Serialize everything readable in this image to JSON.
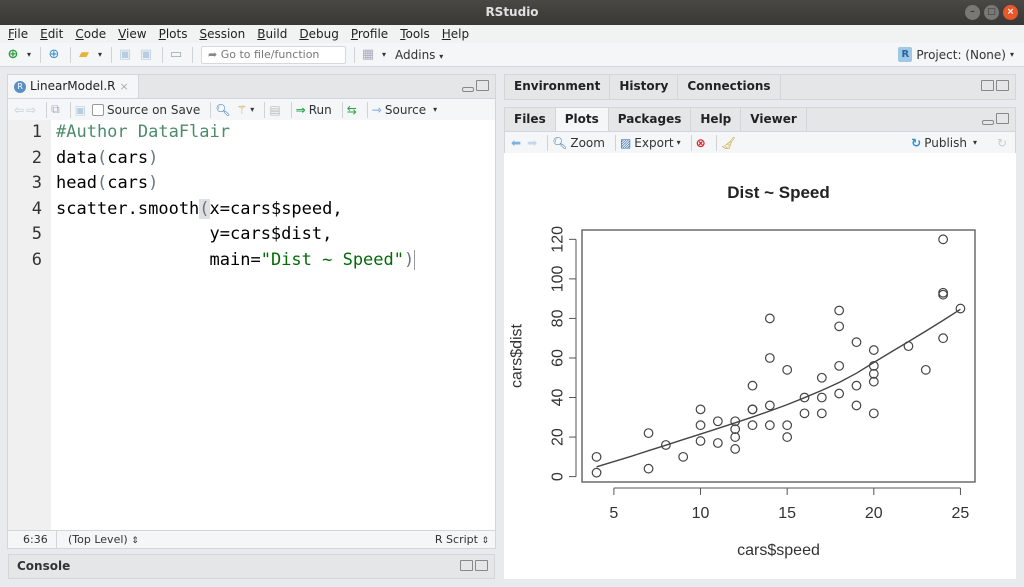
{
  "window": {
    "title": "RStudio",
    "controls": [
      "minimize",
      "maximize",
      "close"
    ]
  },
  "menubar": {
    "items": [
      {
        "label": "File",
        "u": "F"
      },
      {
        "label": "Edit",
        "u": "E"
      },
      {
        "label": "Code",
        "u": "C"
      },
      {
        "label": "View",
        "u": "V"
      },
      {
        "label": "Plots",
        "u": "P"
      },
      {
        "label": "Session",
        "u": "S"
      },
      {
        "label": "Build",
        "u": "B"
      },
      {
        "label": "Debug",
        "u": "D"
      },
      {
        "label": "Profile",
        "u": "P"
      },
      {
        "label": "Tools",
        "u": "T"
      },
      {
        "label": "Help",
        "u": "H"
      }
    ]
  },
  "main_toolbar": {
    "goto_placeholder": "Go to file/function",
    "addins_label": "Addins",
    "project_label": "Project: (None)"
  },
  "source_pane": {
    "tab_label": "LinearModel.R",
    "source_on_save_label": "Source on Save",
    "source_on_save_checked": false,
    "run_label": "Run",
    "source_label": "Source",
    "code_lines": [
      {
        "n": "1",
        "text": "#Author DataFlair"
      },
      {
        "n": "2",
        "text": "data(cars)"
      },
      {
        "n": "3",
        "text": "head(cars)"
      },
      {
        "n": "4",
        "text": "scatter.smooth(x=cars$speed,"
      },
      {
        "n": "5",
        "text": "               y=cars$dist,"
      },
      {
        "n": "6",
        "text": "               main=\"Dist ~ Speed\")"
      }
    ],
    "status": {
      "position": "6:36",
      "scope": "(Top Level)",
      "file_type": "R Script"
    }
  },
  "console_pane": {
    "label": "Console"
  },
  "env_pane": {
    "tabs": [
      "Environment",
      "History",
      "Connections"
    ],
    "active_tab": "Environment"
  },
  "files_pane": {
    "tabs": [
      "Files",
      "Plots",
      "Packages",
      "Help",
      "Viewer"
    ],
    "active_tab": "Plots",
    "zoom_label": "Zoom",
    "export_label": "Export",
    "publish_label": "Publish"
  },
  "chart_data": {
    "type": "scatter",
    "title": "Dist ~ Speed",
    "xlabel": "cars$speed",
    "ylabel": "cars$dist",
    "xlim": [
      3.16,
      25.84
    ],
    "ylim": [
      -2.72,
      124.72
    ],
    "xticks": [
      5,
      10,
      15,
      20,
      25
    ],
    "yticks": [
      0,
      20,
      40,
      60,
      80,
      100,
      120
    ],
    "grid": false,
    "legend": "none",
    "series": [
      {
        "name": "points",
        "x": [
          4,
          4,
          7,
          7,
          8,
          9,
          10,
          10,
          10,
          11,
          11,
          12,
          12,
          12,
          12,
          13,
          13,
          13,
          13,
          14,
          14,
          14,
          14,
          15,
          15,
          15,
          16,
          16,
          17,
          17,
          17,
          18,
          18,
          18,
          18,
          19,
          19,
          19,
          20,
          20,
          20,
          20,
          20,
          22,
          23,
          24,
          24,
          24,
          24,
          25
        ],
        "y": [
          2,
          10,
          4,
          22,
          16,
          10,
          18,
          26,
          34,
          17,
          28,
          14,
          20,
          24,
          28,
          26,
          34,
          34,
          46,
          26,
          36,
          60,
          80,
          20,
          26,
          54,
          32,
          40,
          32,
          40,
          50,
          42,
          56,
          76,
          84,
          36,
          46,
          68,
          32,
          48,
          52,
          56,
          64,
          66,
          54,
          70,
          92,
          93,
          120,
          85
        ]
      },
      {
        "name": "loess smooth",
        "x": [
          4,
          5,
          6,
          7,
          8,
          9,
          10,
          11,
          12,
          13,
          14,
          15,
          16,
          17,
          18,
          19,
          20,
          21,
          22,
          23,
          24,
          25
        ],
        "y": [
          4.96,
          7.6,
          10.3,
          13.1,
          15.9,
          18.7,
          21.5,
          24.4,
          27.2,
          30.1,
          33.2,
          36.4,
          39.9,
          43.6,
          47.6,
          52.3,
          57.7,
          63.0,
          68.3,
          73.6,
          79.0,
          84.6
        ]
      }
    ]
  }
}
